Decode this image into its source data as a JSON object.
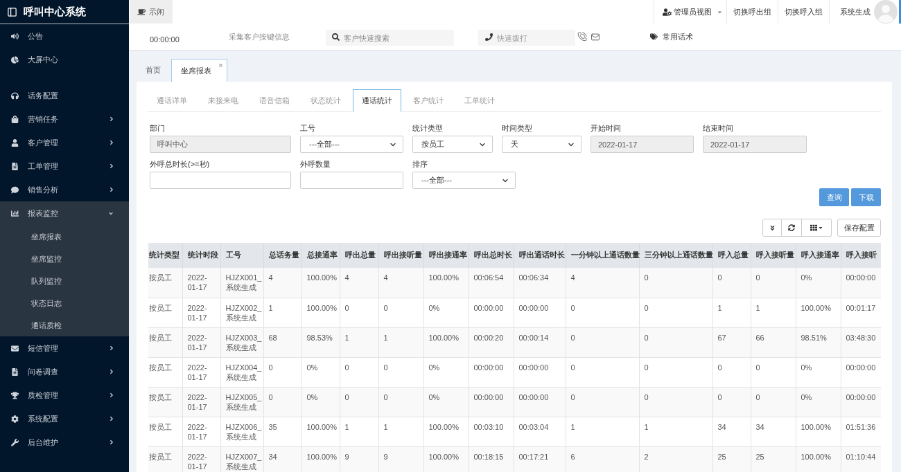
{
  "sidebar": {
    "title": "呼叫中心系统",
    "groups": [
      {
        "items": [
          {
            "label": "公告",
            "kind": "link"
          },
          {
            "label": "大屏中心",
            "kind": "link"
          }
        ]
      },
      {
        "items": [
          {
            "label": "话务配置",
            "kind": "link"
          },
          {
            "label": "营销任务",
            "kind": "menu",
            "expanded": false
          },
          {
            "label": "客户管理",
            "kind": "menu",
            "expanded": false
          },
          {
            "label": "工单管理",
            "kind": "menu",
            "expanded": false
          },
          {
            "label": "销售分析",
            "kind": "menu",
            "expanded": false
          },
          {
            "label": "报表监控",
            "kind": "menu",
            "expanded": true,
            "children": [
              {
                "label": "坐席报表"
              },
              {
                "label": "坐席监控"
              },
              {
                "label": "队列监控"
              },
              {
                "label": "状态日志"
              },
              {
                "label": "通话质检"
              }
            ]
          },
          {
            "label": "短信管理",
            "kind": "menu",
            "expanded": false
          },
          {
            "label": "问卷调查",
            "kind": "menu",
            "expanded": false
          },
          {
            "label": "质检管理",
            "kind": "menu",
            "expanded": false
          },
          {
            "label": "系统配置",
            "kind": "menu",
            "expanded": false
          },
          {
            "label": "后台维护",
            "kind": "menu",
            "expanded": false
          }
        ]
      }
    ]
  },
  "header": {
    "status_button": "示闲",
    "role_menu": "管理员视图",
    "buttons": [
      "切换呼出组",
      "切换呼入组"
    ],
    "user_name": "系统生成"
  },
  "quickbar": {
    "timer": "00:00:00",
    "collect_link": "采集客户按键信息",
    "search": {
      "placeholder": "客户快速搜索"
    },
    "dial": {
      "placeholder": "快速拨打"
    },
    "phrases_button": "常用话术"
  },
  "page_tabs": [
    {
      "label": "首页",
      "selected": false,
      "closable": false
    },
    {
      "label": "坐席报表",
      "selected": true,
      "closable": true
    }
  ],
  "report_tabs": [
    {
      "label": "通话详单",
      "selected": false
    },
    {
      "label": "未接来电",
      "selected": false
    },
    {
      "label": "语音信箱",
      "selected": false
    },
    {
      "label": "状态统计",
      "selected": false
    },
    {
      "label": "通话统计",
      "selected": true
    },
    {
      "label": "客户统计",
      "selected": false
    },
    {
      "label": "工单统计",
      "selected": false
    }
  ],
  "filters": {
    "rows": [
      [
        {
          "label": "部门",
          "kind": "readonly",
          "value": "呼叫中心"
        },
        {
          "label": "工号",
          "kind": "select",
          "value": "---全部---"
        },
        {
          "label": "统计类型",
          "kind": "select",
          "value": "按员工"
        },
        {
          "label": "时间类型",
          "kind": "select",
          "value": "天"
        },
        {
          "label": "开始时间",
          "kind": "readonly",
          "value": "2022-01-17"
        },
        {
          "label": "结束时间",
          "kind": "readonly",
          "value": "2022-01-17"
        }
      ],
      [
        {
          "label": "外呼总时长(>=秒)",
          "kind": "text"
        },
        {
          "label": "外呼数量",
          "kind": "text"
        },
        {
          "label": "排序",
          "kind": "select",
          "value": "---全部---"
        }
      ]
    ],
    "buttons": [
      "查询",
      "下载"
    ]
  },
  "table_toolbar": {
    "save_button": "保存配置"
  },
  "table": {
    "columns": [
      "统计类型",
      "统计时段",
      "工号",
      "总话务量",
      "总接通率",
      "呼出总量",
      "呼出接听量",
      "呼出接通率",
      "呼出总时长",
      "呼出通话时长",
      "一分钟以上通话数量",
      "三分钟以上通话数量",
      "呼入总量",
      "呼入接听量",
      "呼入接通率",
      "呼入接听"
    ],
    "rows": [
      [
        "按员工",
        "2022-01-17",
        "HJZX001_系统生成",
        "4",
        "100.00%",
        "4",
        "4",
        "100.00%",
        "00:06:54",
        "00:06:34",
        "4",
        "0",
        "0",
        "0",
        "0%",
        "00:00:00"
      ],
      [
        "按员工",
        "2022-01-17",
        "HJZX002_系统生成",
        "1",
        "100.00%",
        "0",
        "0",
        "0%",
        "00:00:00",
        "00:00:00",
        "0",
        "0",
        "1",
        "1",
        "100.00%",
        "00:01:17"
      ],
      [
        "按员工",
        "2022-01-17",
        "HJZX003_系统生成",
        "68",
        "98.53%",
        "1",
        "1",
        "100.00%",
        "00:00:20",
        "00:00:14",
        "0",
        "0",
        "67",
        "66",
        "98.51%",
        "03:48:30"
      ],
      [
        "按员工",
        "2022-01-17",
        "HJZX004_系统生成",
        "0",
        "0%",
        "0",
        "0",
        "0%",
        "00:00:00",
        "00:00:00",
        "0",
        "0",
        "0",
        "0",
        "0%",
        "00:00:00"
      ],
      [
        "按员工",
        "2022-01-17",
        "HJZX005_系统生成",
        "0",
        "0%",
        "0",
        "0",
        "0%",
        "00:00:00",
        "00:00:00",
        "0",
        "0",
        "0",
        "0",
        "0%",
        "00:00:00"
      ],
      [
        "按员工",
        "2022-01-17",
        "HJZX006_系统生成",
        "35",
        "100.00%",
        "1",
        "1",
        "100.00%",
        "00:03:10",
        "00:03:04",
        "1",
        "1",
        "34",
        "34",
        "100.00%",
        "01:51:36"
      ],
      [
        "按员工",
        "2022-01-17",
        "HJZX007_系统生成",
        "34",
        "100.00%",
        "9",
        "9",
        "100.00%",
        "00:18:15",
        "00:17:21",
        "6",
        "2",
        "25",
        "25",
        "100.00%",
        "01:10:44"
      ]
    ]
  }
}
